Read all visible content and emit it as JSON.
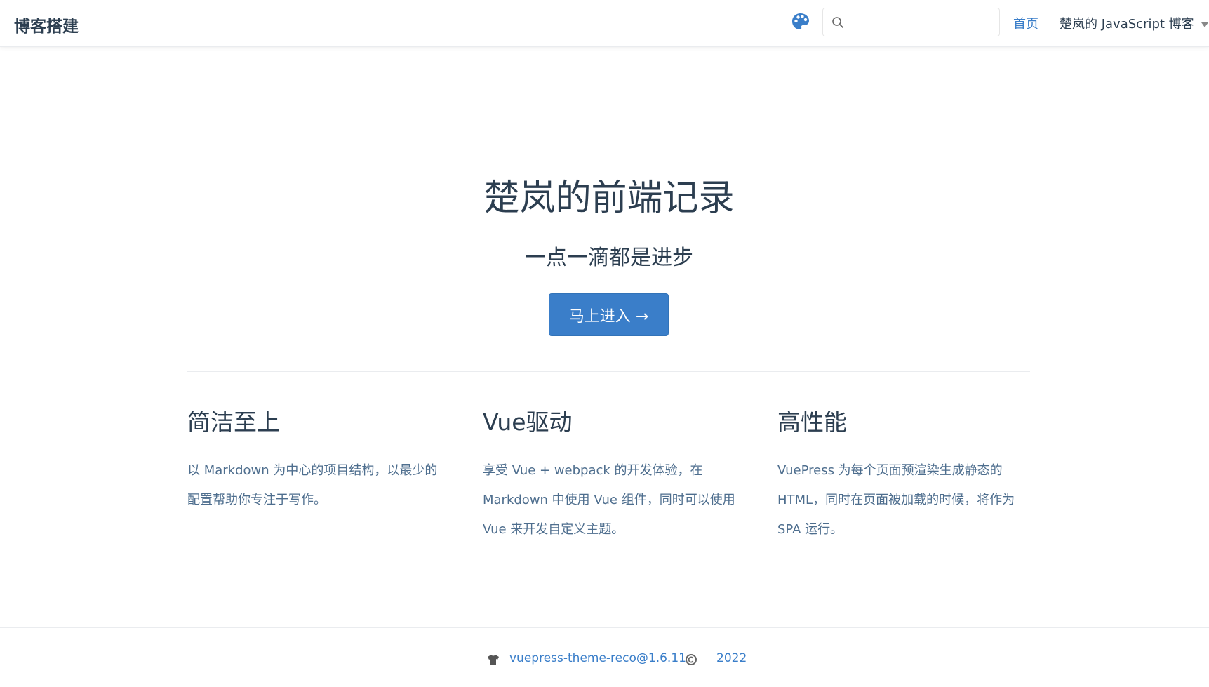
{
  "navbar": {
    "site_name": "博客搭建",
    "search": {
      "value": "",
      "placeholder": ""
    },
    "links": {
      "home": "首页",
      "blog": "楚岚的 JavaScript 博客"
    }
  },
  "hero": {
    "title": "楚岚的前端记录",
    "tagline": "一点一滴都是进步",
    "action_label": "马上进入 →"
  },
  "features": [
    {
      "title": "简洁至上",
      "details": "以 Markdown 为中心的项目结构，以最少的配置帮助你专注于写作。"
    },
    {
      "title": "Vue驱动",
      "details": "享受 Vue + webpack 的开发体验，在 Markdown 中使用 Vue 组件，同时可以使用 Vue 来开发自定义主题。"
    },
    {
      "title": "高性能",
      "details": "VuePress 为每个页面预渲染生成静态的 HTML，同时在页面被加载的时候，将作为 SPA 运行。"
    }
  ],
  "footer": {
    "theme": "vuepress-theme-reco@1.6.11",
    "year": "2022"
  },
  "icons": {
    "palette": "palette-icon",
    "search": "search-icon",
    "dropdown": "caret-down-icon",
    "theme": "shirt-icon",
    "copyright": "copyright-icon"
  },
  "colors": {
    "accent": "#3a7ec9",
    "text": "#2c3e50",
    "muted_text": "#4e6e8e",
    "border": "#eaecef"
  }
}
